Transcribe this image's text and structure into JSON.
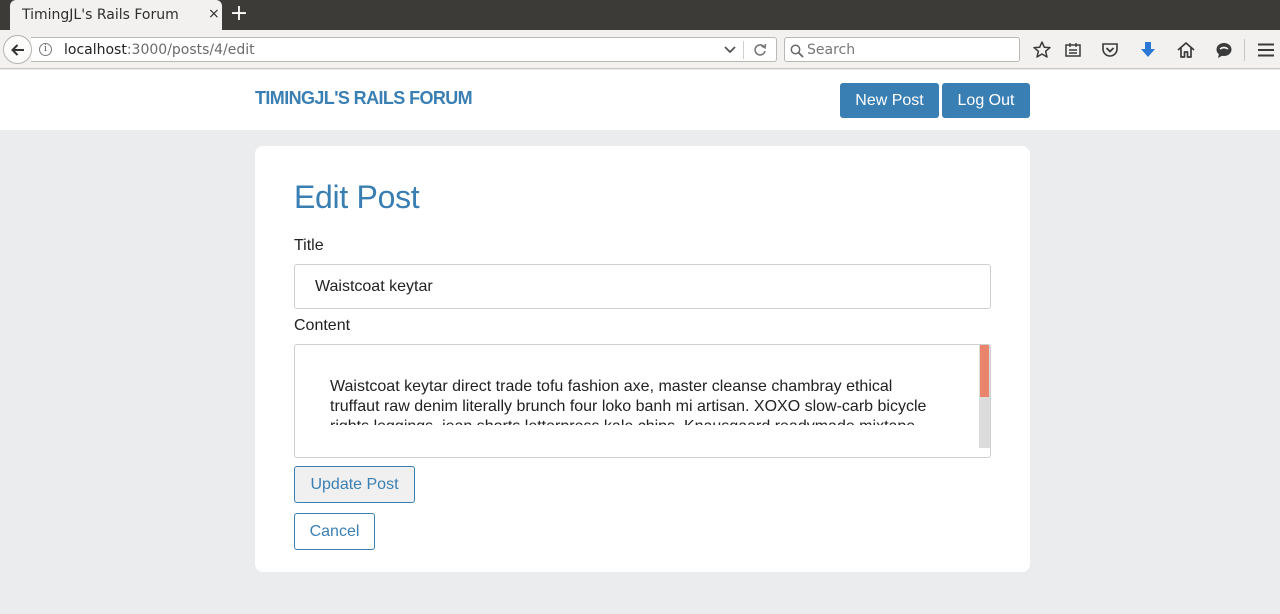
{
  "browser": {
    "tab_title": "TimingJL's Rails Forum",
    "tab_close": "×",
    "new_tab": "+",
    "url_host": "localhost",
    "url_path": ":3000/posts/4/edit",
    "search_placeholder": "Search",
    "info_glyph": "i",
    "toolbar_icons": [
      "back-arrow-icon",
      "info-icon",
      "dropdown-icon",
      "reload-icon",
      "search-icon",
      "bookmark-star-icon",
      "reading-list-icon",
      "pocket-icon",
      "download-icon",
      "home-icon",
      "chat-icon",
      "menu-icon"
    ]
  },
  "header": {
    "brand": "TIMINGJL'S RAILS FORUM",
    "new_post_label": "New Post",
    "logout_label": "Log Out",
    "accent_color": "#3a7fb3"
  },
  "form": {
    "heading": "Edit Post",
    "title_label": "Title",
    "title_value": "Waistcoat keytar",
    "content_label": "Content",
    "content_value": "Waistcoat keytar direct trade tofu fashion axe, master cleanse chambray ethical truffaut raw denim literally brunch four loko banh mi artisan. XOXO slow-carb bicycle rights leggings, jean shorts letterpress kale chips. Knausgaard readymade mixtape whatever",
    "update_label": "Update Post",
    "cancel_label": "Cancel",
    "scrollbar_color": "#e8856c"
  }
}
